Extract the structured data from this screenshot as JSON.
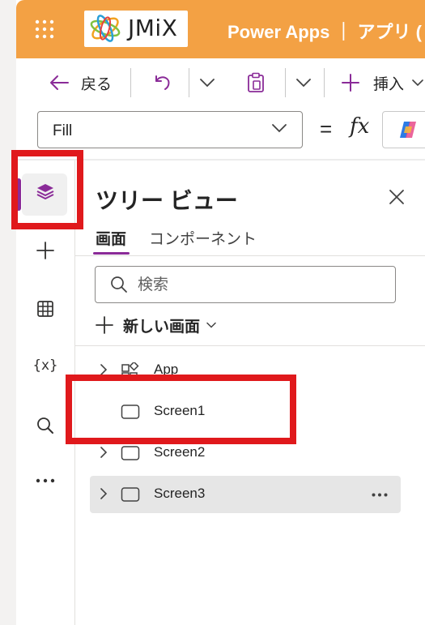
{
  "header": {
    "logo_text": "JMiX",
    "product_title": "Power Apps ｜ アプリ ("
  },
  "command_bar": {
    "back_label": "戻る",
    "insert_label": "挿入"
  },
  "formula_bar": {
    "property_value": "Fill",
    "equals_sign": "=",
    "fx_symbol": "fx"
  },
  "tree_view": {
    "title": "ツリー ビュー",
    "tabs": [
      {
        "label": "画面",
        "active": true
      },
      {
        "label": "コンポーネント",
        "active": false
      }
    ],
    "search_placeholder": "検索",
    "new_screen_label": "新しい画面",
    "nodes": [
      {
        "label": "App",
        "icon": "app-icon",
        "expandable": true,
        "selected": false
      },
      {
        "label": "Screen1",
        "icon": "screen-icon",
        "expandable": false,
        "selected": false
      },
      {
        "label": "Screen2",
        "icon": "screen-icon",
        "expandable": true,
        "selected": false
      },
      {
        "label": "Screen3",
        "icon": "screen-icon",
        "expandable": true,
        "selected": true
      }
    ]
  },
  "left_rail": {
    "items": [
      {
        "icon": "tree-view-layers-icon",
        "active": true
      },
      {
        "icon": "insert-plus-icon",
        "active": false
      },
      {
        "icon": "data-table-icon",
        "active": false
      },
      {
        "icon": "variables-icon",
        "text": "{x}",
        "active": false
      },
      {
        "icon": "search-icon",
        "active": false
      },
      {
        "icon": "more-icon",
        "active": false
      }
    ]
  },
  "colors": {
    "header_bg": "#f3a144",
    "accent_purple": "#8a2b98",
    "highlight_red": "#e0191c",
    "selected_row_bg": "#e6e6e6"
  }
}
